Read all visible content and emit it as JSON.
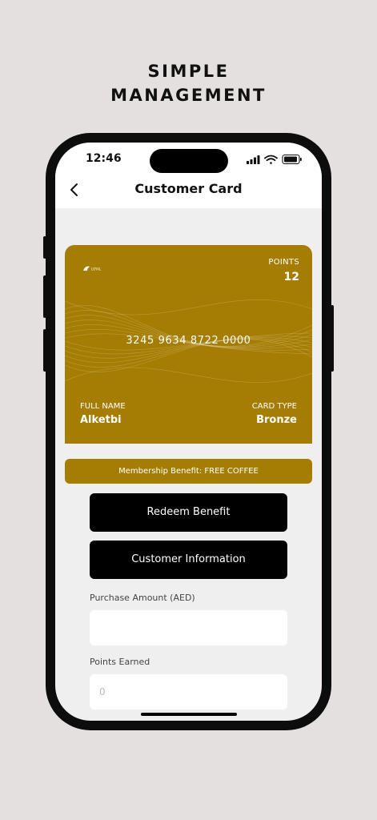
{
  "promo": {
    "line1": "SIMPLE",
    "line2": "MANAGEMENT"
  },
  "status_bar": {
    "time": "12:46",
    "icons": [
      "signal-icon",
      "wifi-icon",
      "battery-icon"
    ]
  },
  "header": {
    "title": "Customer Card",
    "back_icon": "chevron-left-icon"
  },
  "card": {
    "logo_text": "LOYAL",
    "points_label": "POINTS",
    "points_value": "12",
    "number": "3245 9634 8722 0000",
    "full_name_label": "FULL NAME",
    "full_name_value": "Alketbi",
    "card_type_label": "CARD TYPE",
    "card_type_value": "Bronze"
  },
  "benefit": "Membership Benefit: FREE COFFEE",
  "buttons": {
    "redeem": "Redeem Benefit",
    "info": "Customer Information"
  },
  "form": {
    "purchase_label": "Purchase Amount (AED)",
    "purchase_value": "",
    "points_label": "Points Earned",
    "points_placeholder": "0"
  },
  "colors": {
    "card_gold": "#a67d03",
    "background": "#e4e0df",
    "screen_bg": "#efefef"
  }
}
